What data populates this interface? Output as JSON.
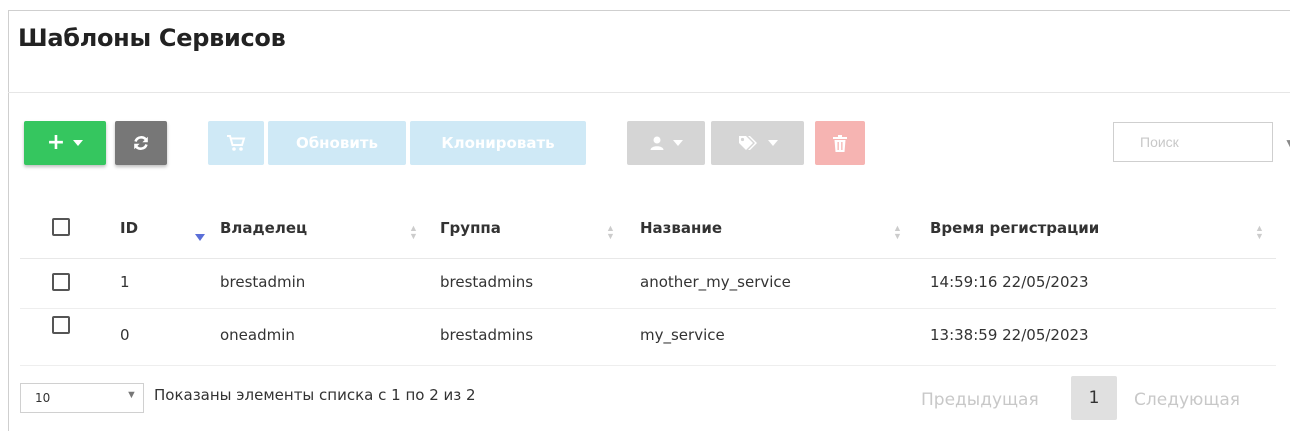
{
  "page": {
    "title": "Шаблоны Сервисов"
  },
  "toolbar": {
    "add_label": "+",
    "update_label": "Обновить",
    "clone_label": "Клонировать"
  },
  "search": {
    "placeholder": "Поиск"
  },
  "table": {
    "columns": [
      "ID",
      "Владелец",
      "Группа",
      "Название",
      "Время регистрации"
    ],
    "rows": [
      {
        "id": "1",
        "owner": "brestadmin",
        "group": "brestadmins",
        "name": "another_my_service",
        "registered": "14:59:16 22/05/2023"
      },
      {
        "id": "0",
        "owner": "oneadmin",
        "group": "brestadmins",
        "name": "my_service",
        "registered": "13:38:59 22/05/2023"
      }
    ]
  },
  "footer": {
    "page_length": "10",
    "info": "Показаны элементы списка с 1 по 2 из 2",
    "prev": "Предыдущая",
    "current_page": "1",
    "next": "Следующая"
  },
  "colors": {
    "add_button": "#35c65f",
    "refresh_button": "#777777",
    "disabled_blue": "#cfe9f6",
    "disabled_grey": "#d5d5d5",
    "disabled_red": "#f6b4b2",
    "sort_active": "#5a6ed8"
  },
  "icons": [
    "plus-icon",
    "refresh-icon",
    "cart-icon",
    "user-icon",
    "tags-icon",
    "trash-icon"
  ]
}
